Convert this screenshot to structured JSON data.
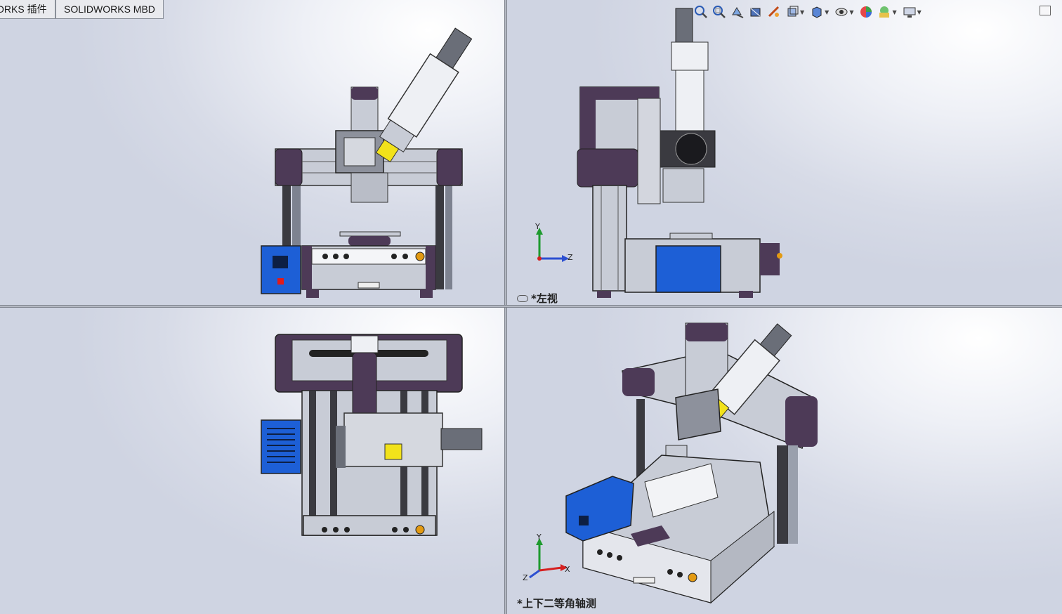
{
  "tabs": [
    {
      "label": "ORKS 插件"
    },
    {
      "label": "SOLIDWORKS MBD"
    }
  ],
  "views": {
    "top_right_label": "*左视",
    "bottom_right_label": "*上下二等角轴测"
  },
  "triad": {
    "y": "Y",
    "z": "Z",
    "x": "X"
  },
  "toolbar": {
    "icons": [
      "zoom-to-fit-icon",
      "zoom-area-icon",
      "previous-view-icon",
      "section-view-icon",
      "dynamic-annotation-icon",
      "view-orientation-icon",
      "display-style-icon",
      "hide-show-items-icon",
      "edit-appearance-icon",
      "apply-scene-icon",
      "view-settings-icon"
    ]
  },
  "colors": {
    "frame_purple": "#4d3a57",
    "rail_silver": "#c8ccd6",
    "control_blue": "#1d5fd6",
    "syringe_yellow": "#f2e21a",
    "axis_y": "#1e9a2e",
    "axis_z": "#2c4fd1",
    "axis_x": "#d62020"
  }
}
